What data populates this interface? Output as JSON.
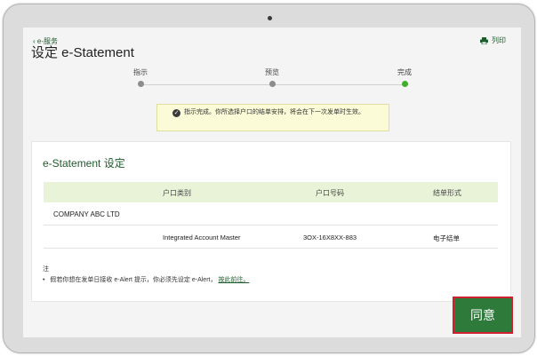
{
  "header": {
    "back_label": "e-服务",
    "title": "设定 e-Statement",
    "print_label": "列印",
    "print_icon": "printer-icon",
    "back_icon": "chevron-left-icon"
  },
  "steps": [
    {
      "label": "指示",
      "state": "done"
    },
    {
      "label": "预览",
      "state": "done"
    },
    {
      "label": "完成",
      "state": "active"
    }
  ],
  "colors": {
    "brand_green": "#1d5b2b",
    "active_step": "#3fae29",
    "button_green": "#2e7a3a",
    "button_highlight": "#d0202f"
  },
  "notice": {
    "icon": "check-circle-icon",
    "text": "指示完成。你所选择户口的结单安排，将会在下一次发单时生效。"
  },
  "section": {
    "title": "e-Statement 设定",
    "columns": [
      "户口类别",
      "户口号码",
      "结单形式"
    ],
    "company": "COMPANY ABC LTD",
    "rows": [
      {
        "type": "Integrated Account Master",
        "number": "3OX-16X8XX-883",
        "format": "电子结单"
      }
    ]
  },
  "notes": {
    "heading": "注",
    "bullet": "•",
    "text": "假若你想在发单日接收 e-Alert 提示，你必须先设定 e-Alert，",
    "link": "按此前往。"
  },
  "actions": {
    "agree_label": "同意"
  }
}
